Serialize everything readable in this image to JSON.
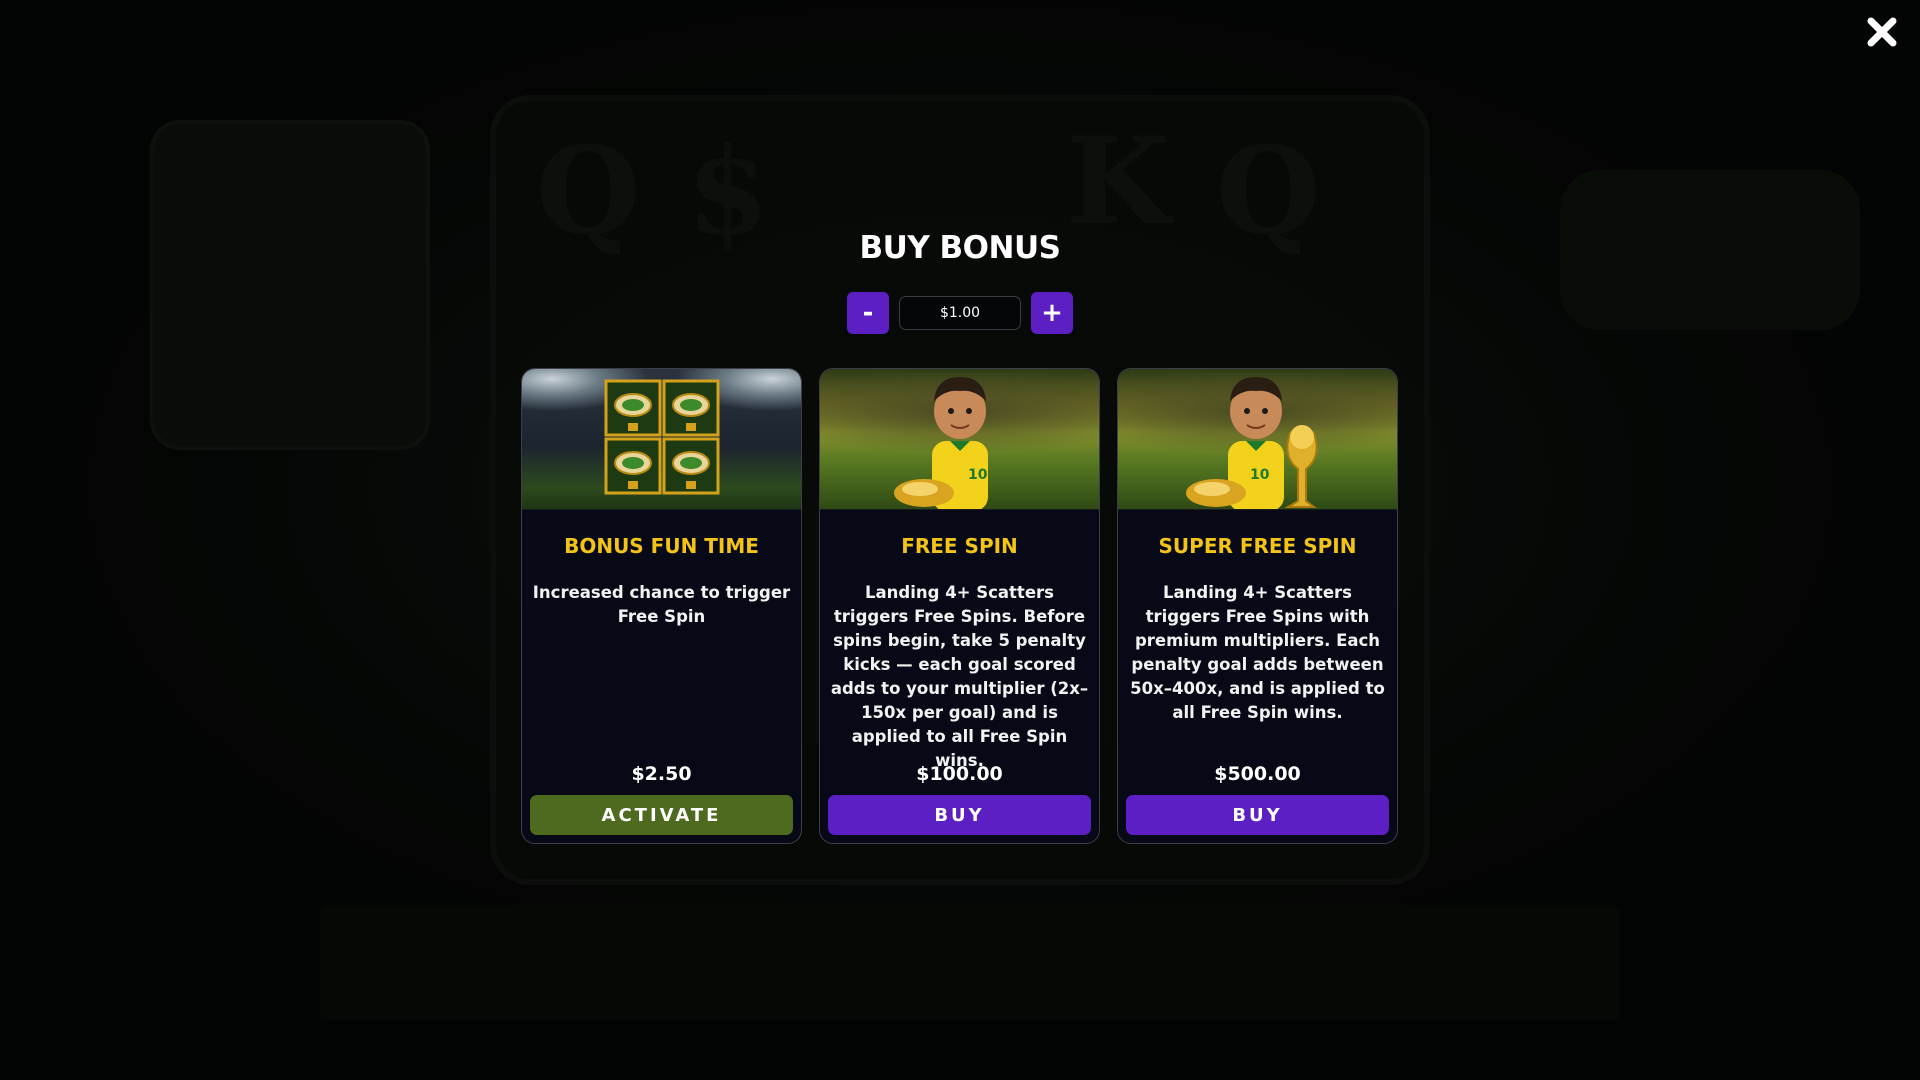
{
  "modal": {
    "title": "BUY BONUS",
    "bet": {
      "minus_label": "-",
      "value": "$1.00",
      "plus_label": "+"
    },
    "cards": [
      {
        "name": "BONUS FUN TIME",
        "description": "Increased chance to trigger Free Spin",
        "price": "$2.50",
        "button_label": "ACTIVATE",
        "image": "four-scatter-stadium-symbols"
      },
      {
        "name": "FREE SPIN",
        "description": "Landing 4+ Scatters triggers Free Spins. Before spins begin, take 5 penalty kicks — each goal scored adds to your multiplier (2x–150x per goal) and is applied to all Free Spin wins.",
        "price": "$100.00",
        "button_label": "BUY",
        "image": "footballer-with-golden-boot"
      },
      {
        "name": "SUPER FREE SPIN",
        "description": "Landing 4+ Scatters triggers Free Spins with premium multipliers. Each penalty goal adds between 50x–400x, and is applied to all Free Spin wins.",
        "price": "$500.00",
        "button_label": "BUY",
        "image": "footballer-with-golden-boot-and-trophy"
      }
    ]
  },
  "colors": {
    "accent_purple": "#5b1fc4",
    "activate_green": "#4d6a1f",
    "title_gold": "#f3c318"
  },
  "icons": {
    "close": "close-icon"
  }
}
